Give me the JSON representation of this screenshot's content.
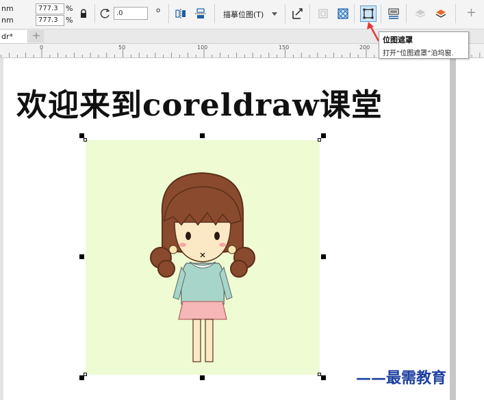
{
  "toolbar": {
    "unit_top": "nm",
    "unit_bottom": "nm",
    "scale_x": "777.3",
    "scale_y": "777.3",
    "percent_top": "%",
    "percent_bottom": "%",
    "rotation_value": ".0",
    "degree_symbol": "o",
    "trace_bitmap_label": "描摹位图(T)",
    "plus_label": "+"
  },
  "tabs": {
    "document_tab": "dr*",
    "add_tab": "+"
  },
  "ruler": {
    "ticks": [
      "0",
      "50",
      "100",
      "150",
      "200"
    ]
  },
  "canvas": {
    "headline": "欢迎来到coreldraw课堂"
  },
  "tooltip": {
    "title": "位图遮罩",
    "description": "打开“位图遮罩”泊坞窗."
  },
  "watermark": {
    "text": "——最需教育"
  },
  "colors": {
    "image_background": "#eefbd3",
    "hair": "#8a4a2d",
    "red_arrow": "#e53935",
    "active_button": "#cfe6f8"
  }
}
